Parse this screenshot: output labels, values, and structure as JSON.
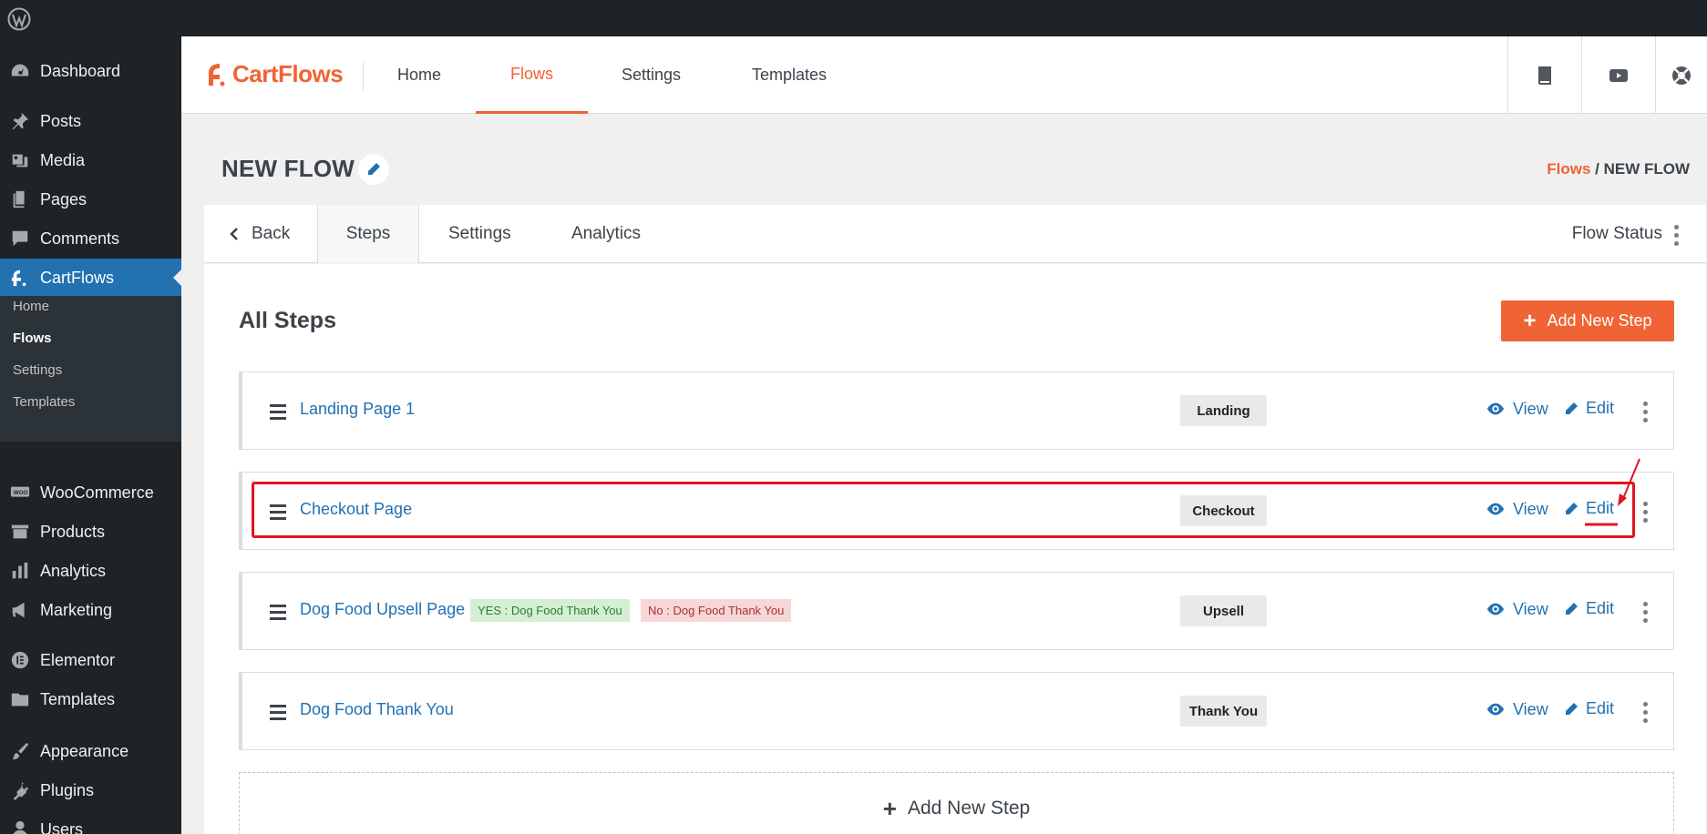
{
  "sidebar": {
    "items": [
      {
        "label": "Dashboard",
        "icon": "dashboard-icon"
      },
      {
        "label": "Posts",
        "icon": "pin-icon"
      },
      {
        "label": "Media",
        "icon": "media-icon"
      },
      {
        "label": "Pages",
        "icon": "pages-icon"
      },
      {
        "label": "Comments",
        "icon": "comments-icon"
      },
      {
        "label": "CartFlows",
        "icon": "cartflows-icon"
      },
      {
        "label": "WooCommerce",
        "icon": "woo-icon"
      },
      {
        "label": "Products",
        "icon": "archive-icon"
      },
      {
        "label": "Analytics",
        "icon": "bar-chart-icon"
      },
      {
        "label": "Marketing",
        "icon": "megaphone-icon"
      },
      {
        "label": "Elementor",
        "icon": "elementor-icon"
      },
      {
        "label": "Templates",
        "icon": "folder-icon"
      },
      {
        "label": "Appearance",
        "icon": "brush-icon"
      },
      {
        "label": "Plugins",
        "icon": "plug-icon"
      },
      {
        "label": "Users",
        "icon": "user-icon"
      }
    ],
    "submenu": [
      "Home",
      "Flows",
      "Settings",
      "Templates"
    ]
  },
  "header": {
    "brand": "CartFlows",
    "nav": [
      "Home",
      "Flows",
      "Settings",
      "Templates"
    ],
    "active_nav": "Flows",
    "icons": [
      "book-icon",
      "youtube-icon",
      "support-icon"
    ]
  },
  "page": {
    "title": "NEW FLOW",
    "breadcrumb_link": "Flows",
    "breadcrumb_sep": " / ",
    "breadcrumb_current": "NEW FLOW"
  },
  "tabs": {
    "back": "Back",
    "steps": "Steps",
    "settings": "Settings",
    "analytics": "Analytics",
    "flow_status": "Flow Status"
  },
  "content": {
    "heading": "All Steps",
    "add_button": "Add New Step",
    "add_bottom": "Add New Step",
    "view_label": "View",
    "edit_label": "Edit",
    "steps": [
      {
        "name": "Landing Page 1",
        "type": "Landing"
      },
      {
        "name": "Checkout Page",
        "type": "Checkout"
      },
      {
        "name": "Dog Food Upsell Page",
        "type": "Upsell",
        "yes_badge": "YES : Dog Food Thank You",
        "no_badge": "No : Dog Food Thank You"
      },
      {
        "name": "Dog Food Thank You",
        "type": "Thank You"
      }
    ]
  },
  "colors": {
    "accent": "#f06335",
    "link": "#2271b1",
    "admin_bg": "#1d2327",
    "annotation": "#e0141e"
  }
}
